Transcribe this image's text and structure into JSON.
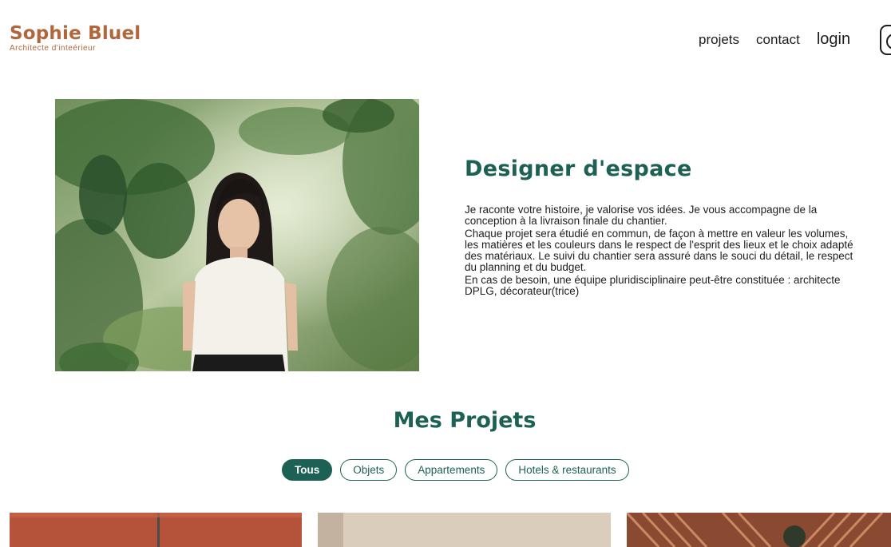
{
  "header": {
    "logo_title": "Sophie Bluel",
    "logo_subtitle": "Architecte d'inteérieur",
    "nav": [
      {
        "label": "projets"
      },
      {
        "label": "contact"
      },
      {
        "label": "login"
      }
    ],
    "social_icon": "instagram-icon"
  },
  "intro": {
    "photo_icon": "portrait-photo",
    "heading": "Designer d'espace",
    "paragraphs": [
      "Je raconte votre histoire, je valorise vos idées. Je vous accompagne de la\nconception à la livraison finale du chantier.",
      "Chaque projet sera étudié en commun, de façon à mettre en valeur les volumes,\nles matières et les couleurs dans le respect de l'esprit des lieux et le choix adapté\ndes matériaux. Le suivi du chantier sera assuré dans le souci du détail, le respect\ndu planning et du budget.",
      "En cas de besoin, une équipe pluridisciplinaire peut-être constituée : architecte\nDPLG, décorateur(trice)"
    ]
  },
  "projects": {
    "title": "Mes Projets",
    "filters": [
      {
        "label": "Tous",
        "active": true
      },
      {
        "label": "Objets",
        "active": false
      },
      {
        "label": "Appartements",
        "active": false
      },
      {
        "label": "Hotels & restaurants",
        "active": false
      }
    ]
  },
  "colors": {
    "brand": "#b1663c",
    "accent": "#1d6154",
    "text": "#1d1d1d"
  }
}
